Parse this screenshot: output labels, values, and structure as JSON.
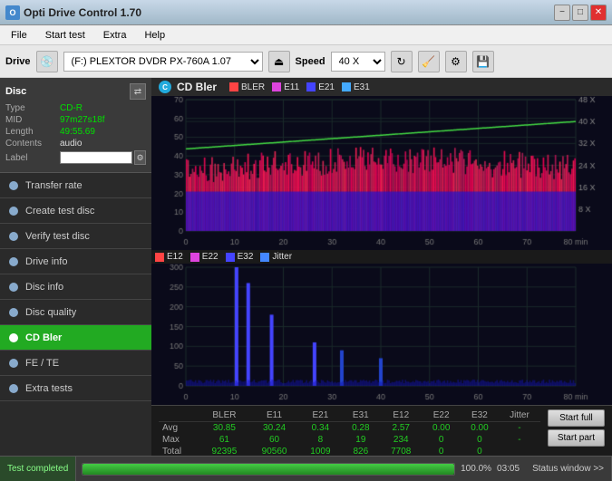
{
  "app": {
    "title": "Opti Drive Control 1.70"
  },
  "title_controls": {
    "minimize": "−",
    "maximize": "□",
    "close": "✕"
  },
  "menu": {
    "items": [
      "File",
      "Start test",
      "Extra",
      "Help"
    ]
  },
  "toolbar": {
    "drive_label": "Drive",
    "drive_value": "(F:)  PLEXTOR DVDR   PX-760A 1.07",
    "speed_label": "Speed",
    "speed_value": "40 X"
  },
  "sidebar": {
    "disc_title": "Disc",
    "disc_info": {
      "type_label": "Type",
      "type_value": "CD-R",
      "mid_label": "MID",
      "mid_value": "97m27s18f",
      "length_label": "Length",
      "length_value": "49:55.69",
      "contents_label": "Contents",
      "contents_value": "audio",
      "label_label": "Label"
    },
    "nav_items": [
      {
        "id": "transfer-rate",
        "label": "Transfer rate"
      },
      {
        "id": "create-test-disc",
        "label": "Create test disc"
      },
      {
        "id": "verify-test-disc",
        "label": "Verify test disc"
      },
      {
        "id": "drive-info",
        "label": "Drive info"
      },
      {
        "id": "disc-info",
        "label": "Disc info"
      },
      {
        "id": "disc-quality",
        "label": "Disc quality"
      },
      {
        "id": "cd-bler",
        "label": "CD Bler",
        "active": true
      },
      {
        "id": "fe-te",
        "label": "FE / TE"
      },
      {
        "id": "extra-tests",
        "label": "Extra tests"
      }
    ]
  },
  "chart": {
    "title": "CD Bler",
    "top_legend": [
      {
        "label": "BLER",
        "color": "#ff4444"
      },
      {
        "label": "E11",
        "color": "#dd44dd"
      },
      {
        "label": "E21",
        "color": "#4444ff"
      },
      {
        "label": "E31",
        "color": "#44aaff"
      }
    ],
    "bottom_legend": [
      {
        "label": "E12",
        "color": "#ff4444"
      },
      {
        "label": "E22",
        "color": "#dd44dd"
      },
      {
        "label": "E32",
        "color": "#4444ff"
      },
      {
        "label": "Jitter",
        "color": "#4444ff"
      }
    ],
    "top_y_axis": [
      "70",
      "60",
      "50",
      "40",
      "30",
      "20",
      "10",
      "0"
    ],
    "top_y_right": [
      "48 X",
      "40 X",
      "32 X",
      "24 X",
      "16 X",
      "8 X"
    ],
    "bottom_y_axis": [
      "300",
      "250",
      "200",
      "150",
      "100",
      "50",
      "0"
    ],
    "x_axis": [
      "0",
      "10",
      "20",
      "30",
      "40",
      "50",
      "60",
      "70",
      "80 min"
    ]
  },
  "stats": {
    "headers": [
      "",
      "BLER",
      "E11",
      "E21",
      "E31",
      "E12",
      "E22",
      "E32",
      "Jitter"
    ],
    "rows": [
      {
        "label": "Avg",
        "values": [
          "30.85",
          "30.24",
          "0.34",
          "0.28",
          "2.57",
          "0.00",
          "0.00",
          "-"
        ]
      },
      {
        "label": "Max",
        "values": [
          "61",
          "60",
          "8",
          "19",
          "234",
          "0",
          "0",
          "-"
        ]
      },
      {
        "label": "Total",
        "values": [
          "92395",
          "90560",
          "1009",
          "826",
          "7708",
          "0",
          "0",
          ""
        ]
      }
    ],
    "buttons": [
      "Start full",
      "Start part"
    ]
  },
  "status_bar": {
    "status_window_label": "Status window >>",
    "test_status": "Test completed",
    "progress": 100.0,
    "progress_text": "100.0%",
    "time": "03:05"
  }
}
